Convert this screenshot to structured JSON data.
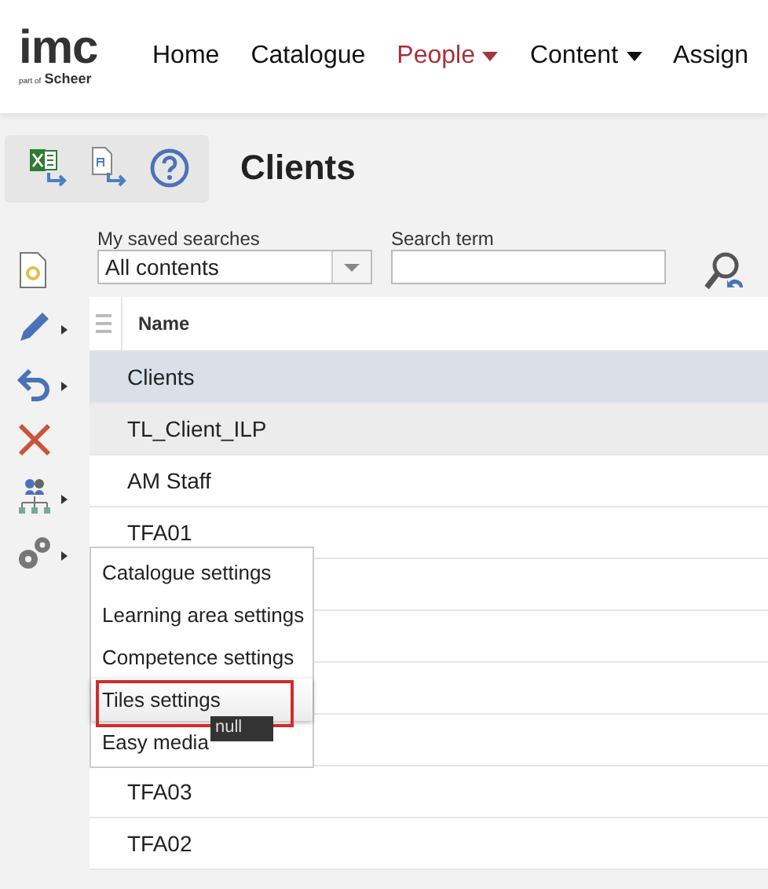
{
  "header": {
    "logo": {
      "main": "imc",
      "prefix": "part of",
      "brand": "Scheer"
    },
    "nav": [
      {
        "label": "Home",
        "selected": false,
        "dropdown": false
      },
      {
        "label": "Catalogue",
        "selected": false,
        "dropdown": false
      },
      {
        "label": "People",
        "selected": true,
        "dropdown": true
      },
      {
        "label": "Content",
        "selected": false,
        "dropdown": true
      },
      {
        "label": "Assign",
        "selected": false,
        "dropdown": false
      }
    ]
  },
  "page": {
    "title": "Clients"
  },
  "search": {
    "saved_label": "My saved searches",
    "saved_value": "All contents",
    "term_label": "Search term"
  },
  "side_actions": [
    {
      "kind": "new",
      "submenu": false
    },
    {
      "kind": "edit",
      "submenu": true
    },
    {
      "kind": "undo",
      "submenu": true
    },
    {
      "kind": "delete",
      "submenu": false
    },
    {
      "kind": "hierarchy",
      "submenu": true
    },
    {
      "kind": "settings",
      "submenu": true
    }
  ],
  "table": {
    "columns": [
      "Name"
    ],
    "rows": [
      {
        "name": "Clients",
        "selected": true,
        "hovered": false
      },
      {
        "name": "TL_Client_ILP",
        "selected": false,
        "hovered": true
      },
      {
        "name": "AM Staff",
        "selected": false,
        "hovered": false
      },
      {
        "name": "TFA01",
        "selected": false,
        "hovered": false
      },
      {
        "selected": false,
        "hovered": false
      },
      {
        "selected": false,
        "hovered": false
      },
      {
        "selected": false,
        "hovered": false
      },
      {
        "selected": false,
        "hovered": false
      },
      {
        "name": "TFA03",
        "selected": false,
        "hovered": false
      },
      {
        "name": "TFA02",
        "selected": false,
        "hovered": false
      }
    ]
  },
  "context_menu": {
    "items": [
      {
        "label": "Catalogue settings",
        "hovered": false,
        "annotated": false
      },
      {
        "label": "Learning area settings",
        "hovered": false,
        "annotated": false
      },
      {
        "label": "Competence settings",
        "hovered": false,
        "annotated": false
      },
      {
        "label": "Tiles settings",
        "hovered": true,
        "annotated": true
      },
      {
        "label": "Easy media",
        "hovered": false,
        "annotated": false
      }
    ],
    "tooltip": "null"
  }
}
